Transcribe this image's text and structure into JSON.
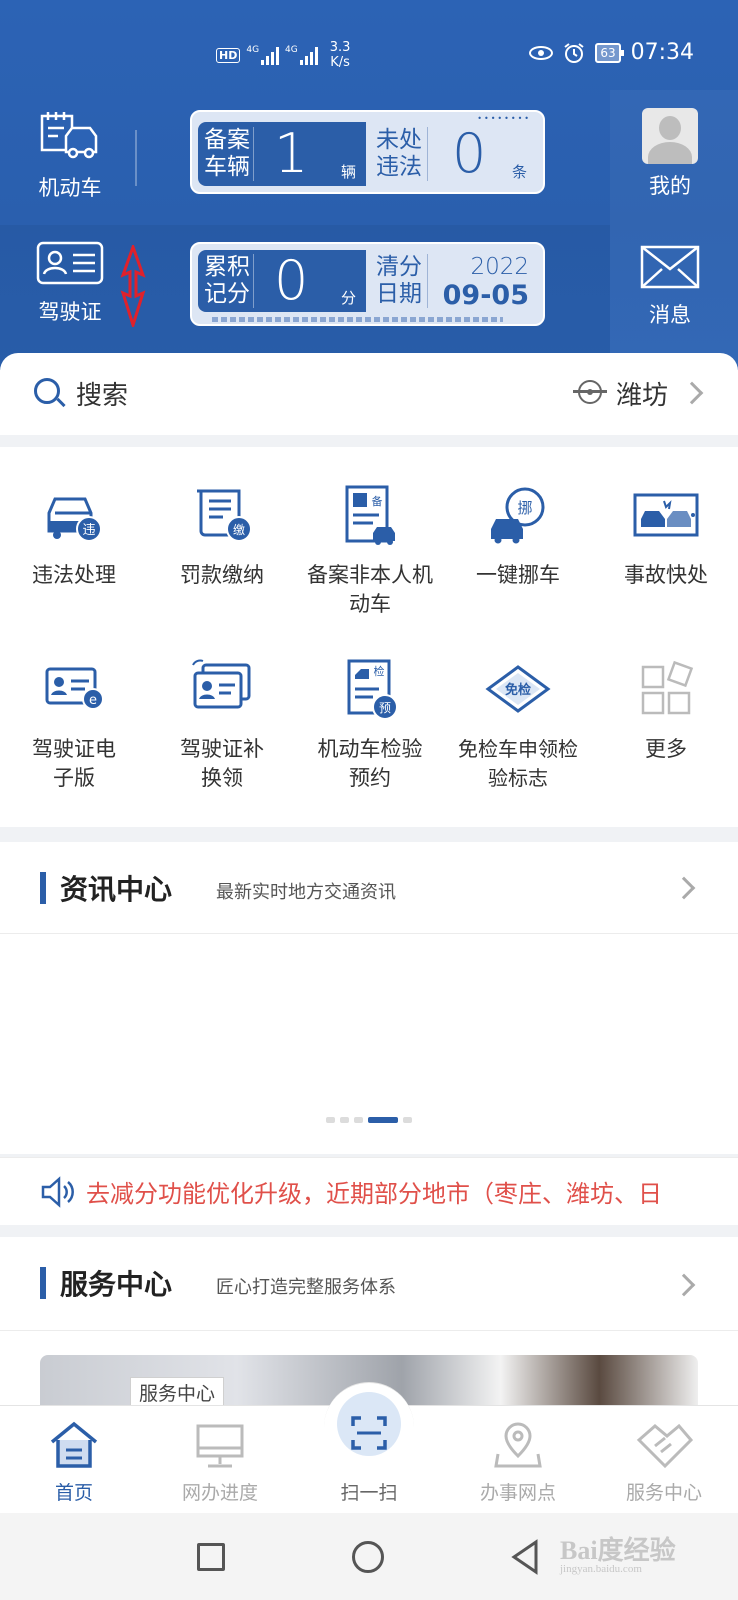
{
  "status_bar": {
    "hd": "HD",
    "sim_small": "1",
    "net1": "4G",
    "net2": "4G",
    "speed_value": "3.3",
    "speed_unit": "K/s",
    "battery": "63",
    "time": "07:34"
  },
  "header": {
    "vehicle_label": "机动车",
    "license_label": "驾驶证",
    "mine_label": "我的",
    "message_label": "消息",
    "plate1": {
      "left_key": "备案车辆",
      "left_value": "1",
      "left_unit": "辆",
      "right_key": "未处违法",
      "right_value": "0",
      "right_unit": "条"
    },
    "plate2": {
      "left_key": "累积记分",
      "left_value": "0",
      "left_unit": "分",
      "right_key": "清分日期",
      "year": "2022",
      "date": "09-05"
    }
  },
  "search": {
    "placeholder": "搜索",
    "location": "潍坊"
  },
  "services": [
    {
      "label": "违法处理",
      "icon": "car-violation-icon"
    },
    {
      "label": "罚款缴纳",
      "icon": "fine-payment-icon"
    },
    {
      "label": "备案非本人机动车",
      "icon": "vehicle-registration-icon"
    },
    {
      "label": "一键挪车",
      "icon": "move-car-icon"
    },
    {
      "label": "事故快处",
      "icon": "accident-icon"
    },
    {
      "label": "驾驶证电子版",
      "icon": "e-license-icon"
    },
    {
      "label": "驾驶证补换领",
      "icon": "license-replace-icon"
    },
    {
      "label": "机动车检验预约",
      "icon": "inspection-booking-icon"
    },
    {
      "label": "免检车申领检验标志",
      "icon": "exempt-inspection-icon"
    },
    {
      "label": "更多",
      "icon": "more-grid-icon"
    }
  ],
  "icon_texts": {
    "wei": "违",
    "jiao": "缴",
    "bei": "备",
    "nuo": "挪",
    "jian": "检",
    "yu": "预",
    "mianjian": "免检"
  },
  "news": {
    "title": "资讯中心",
    "subtitle": "最新实时地方交通资讯",
    "carousel_pages": 5,
    "carousel_active": 4
  },
  "notice": {
    "text": "去减分功能优化升级，近期部分地市（枣庄、潍坊、日"
  },
  "service_center": {
    "title": "服务中心",
    "subtitle": "匠心打造完整服务体系",
    "banner_tag": "服务中心"
  },
  "bottom_nav": [
    {
      "label": "首页",
      "icon": "home-icon",
      "active": true
    },
    {
      "label": "网办进度",
      "icon": "monitor-icon",
      "active": false
    },
    {
      "label": "扫一扫",
      "icon": "scan-icon",
      "active": false
    },
    {
      "label": "办事网点",
      "icon": "location-pin-icon",
      "active": false
    },
    {
      "label": "服务中心",
      "icon": "handshake-icon",
      "active": false
    }
  ],
  "watermark": {
    "brand": "Bai度经验",
    "url": "jingyan.baidu.com"
  },
  "colors": {
    "primary": "#2b5ea8",
    "header_bg": "#2c63b5",
    "notice_text": "#e0504a"
  }
}
